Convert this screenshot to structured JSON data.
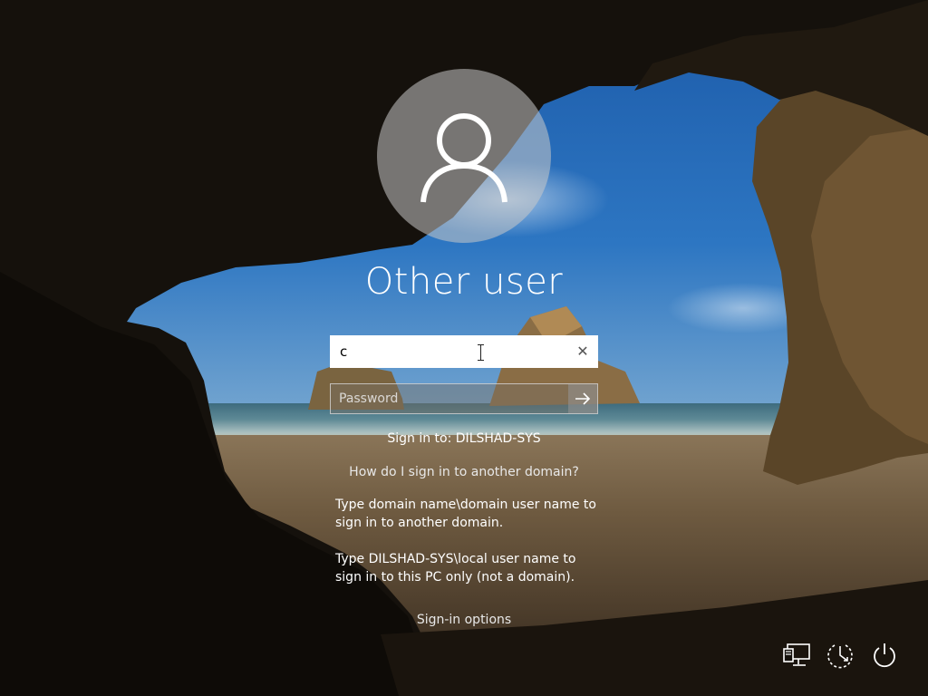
{
  "lock_screen": {
    "user_display_name": "Other user",
    "username_value": "c",
    "password_placeholder": "Password",
    "sign_in_to": "Sign in to: DILSHAD-SYS",
    "help_link": "How do I sign in to another domain?",
    "help_text_1": "Type domain name\\domain user name to sign in to another domain.",
    "help_text_2": "Type DILSHAD-SYS\\local user name to sign in to this PC only (not a domain).",
    "sign_in_options": "Sign-in options"
  },
  "icons": {
    "avatar": "person-icon",
    "clear": "close-icon",
    "submit": "arrow-right-icon",
    "network": "network-icon",
    "ease_of_access": "ease-of-access-icon",
    "power": "power-icon"
  },
  "colors": {
    "text": "#ffffff",
    "field_bg": "#ffffff",
    "avatar_bg": "#c8c8c8"
  }
}
